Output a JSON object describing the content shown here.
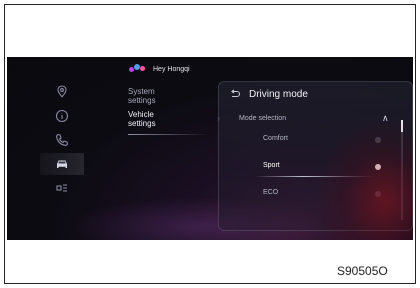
{
  "assistant": {
    "greeting": "Hey Hongqi"
  },
  "sidebar_icons": [
    {
      "name": "navigation-icon"
    },
    {
      "name": "info-icon"
    },
    {
      "name": "phone-icon"
    },
    {
      "name": "car-icon",
      "active": true
    },
    {
      "name": "apps-icon"
    }
  ],
  "menu": {
    "items": [
      {
        "label_line1": "System",
        "label_line2": "settings",
        "active": false
      },
      {
        "label_line1": "Vehicle",
        "label_line2": "settings",
        "active": true
      }
    ]
  },
  "panel": {
    "title": "Driving mode",
    "section_label": "Mode selection",
    "options": [
      {
        "label": "Comfort",
        "selected": false
      },
      {
        "label": "Sport",
        "selected": true
      },
      {
        "label": "ECO",
        "selected": false
      }
    ]
  },
  "figure_code": "S90505O",
  "colors": {
    "screen_bg": "#0a0a0e",
    "accent_red": "#96141e",
    "text_light": "#f2f2f7"
  }
}
